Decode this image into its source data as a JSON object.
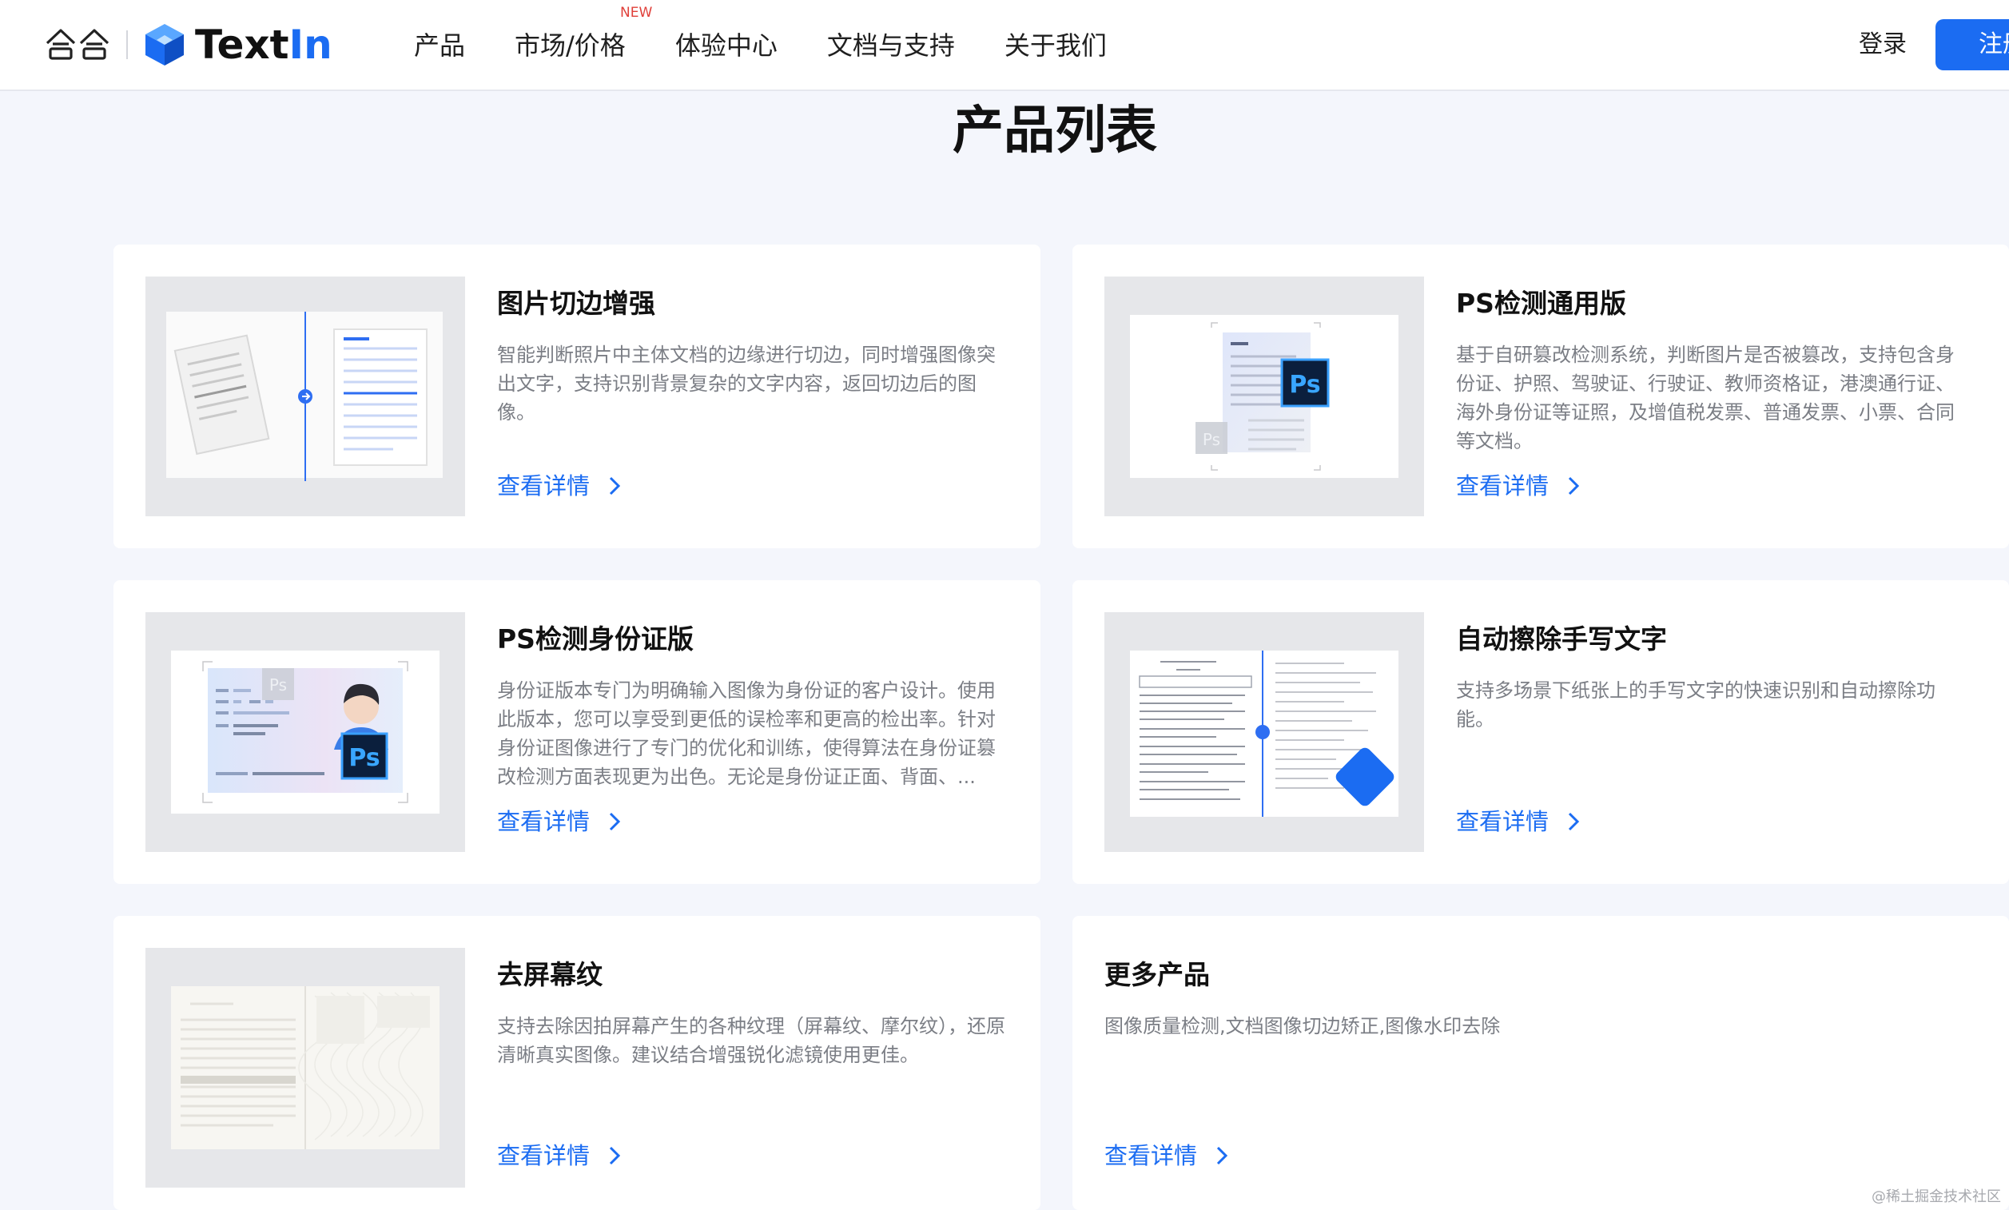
{
  "header": {
    "brand_name_a": "Text",
    "brand_name_b": "In",
    "nav": [
      {
        "label": "产品"
      },
      {
        "label": "市场/价格",
        "badge": "NEW"
      },
      {
        "label": "体验中心"
      },
      {
        "label": "文档与支持"
      },
      {
        "label": "关于我们"
      }
    ],
    "login_label": "登录",
    "register_label": "注册"
  },
  "page_title": "产品列表",
  "cards": [
    {
      "title": "图片切边增强",
      "desc": "智能判断照片中主体文档的边缘进行切边，同时增强图像突出文字，支持识别背景复杂的文字内容，返回切边后的图像。",
      "link": "查看详情"
    },
    {
      "title": "PS检测通用版",
      "desc": "基于自研篡改检测系统，判断图片是否被篡改，支持包含身份证、护照、驾驶证、行驶证、教师资格证，港澳通行证、海外身份证等证照，及增值税发票、普通发票、小票、合同等文档。",
      "link": "查看详情"
    },
    {
      "title": "PS检测身份证版",
      "desc": "身份证版本专门为明确输入图像为身份证的客户设计。使用此版本，您可以享受到更低的误检率和更高的检出率。针对身份证图像进行了专门的优化和训练，使得算法在身份证篡改检测方面表现更为出色。无论是身份证正面、背面、...",
      "link": "查看详情"
    },
    {
      "title": "自动擦除手写文字",
      "desc": "支持多场景下纸张上的手写文字的快速识别和自动擦除功能。",
      "link": "查看详情"
    },
    {
      "title": "去屏幕纹",
      "desc": "支持去除因拍屏幕产生的各种纹理（屏幕纹、摩尔纹），还原清晰真实图像。建议结合增强锐化滤镜使用更佳。",
      "link": "查看详情"
    },
    {
      "title": "更多产品",
      "desc": "图像质量检测,文档图像切边矫正,图像水印去除",
      "link": "查看详情"
    }
  ],
  "thumb_text": {
    "ps": "Ps"
  },
  "watermark": "@稀土掘金技术社区",
  "colors": {
    "brand_blue": "#1b6cf2",
    "page_bg": "#f4f6fc",
    "badge_red": "#e0403a"
  }
}
